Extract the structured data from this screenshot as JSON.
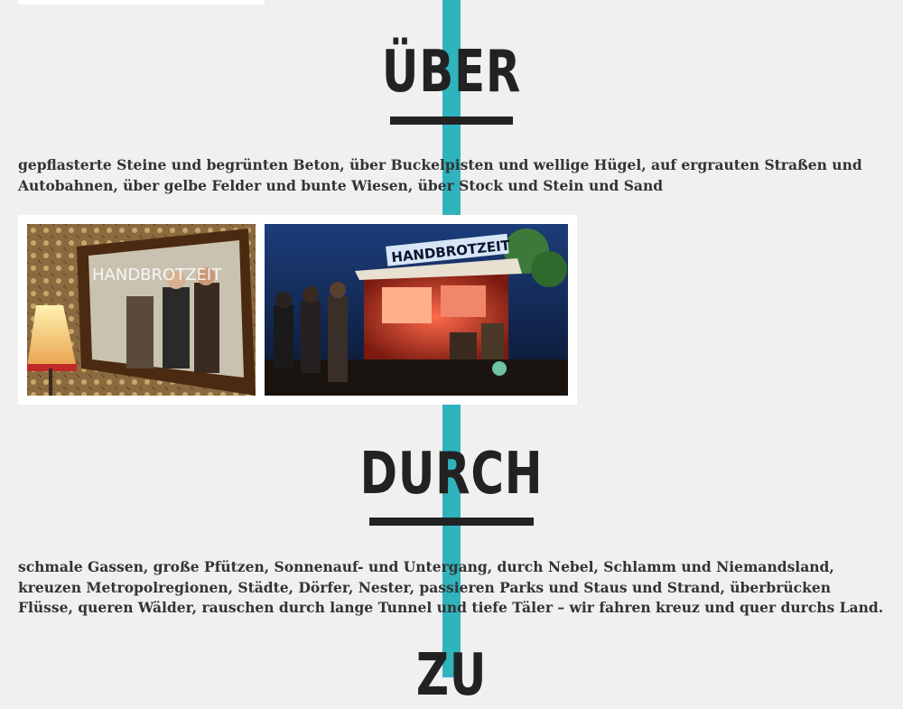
{
  "sections": [
    {
      "title": "ÜBER",
      "text": "gepflasterte Steine und begrünten Beton, über Buckelpisten und wellige Hügel, auf ergrauten Straßen und Autobahnen, über gelbe Felder und bunte Wiesen, über Stock und Stein und Sand"
    },
    {
      "title": "DURCH",
      "text": "schmale Gassen, große Pfützen, Sonnenauf- und Untergang, durch Nebel, Schlamm und Niemandsland, kreuzen Metropolregionen, Städte, Dörfer, Nester, passieren Parks und Staus und Strand, überbrücken Flüsse, queren Wälder, rauschen durch lange Tunnel und tiefe Täler – wir fahren kreuz und quer durchs Land."
    },
    {
      "title": "ZU"
    }
  ],
  "gallery": {
    "photo_b_sign": "HANDBROTZEIT",
    "photo_a_mirror_text": "HANDBROTZEIT"
  },
  "colors": {
    "accent": "#2fb3bd",
    "background": "#f0f0f0",
    "text": "#222222"
  }
}
